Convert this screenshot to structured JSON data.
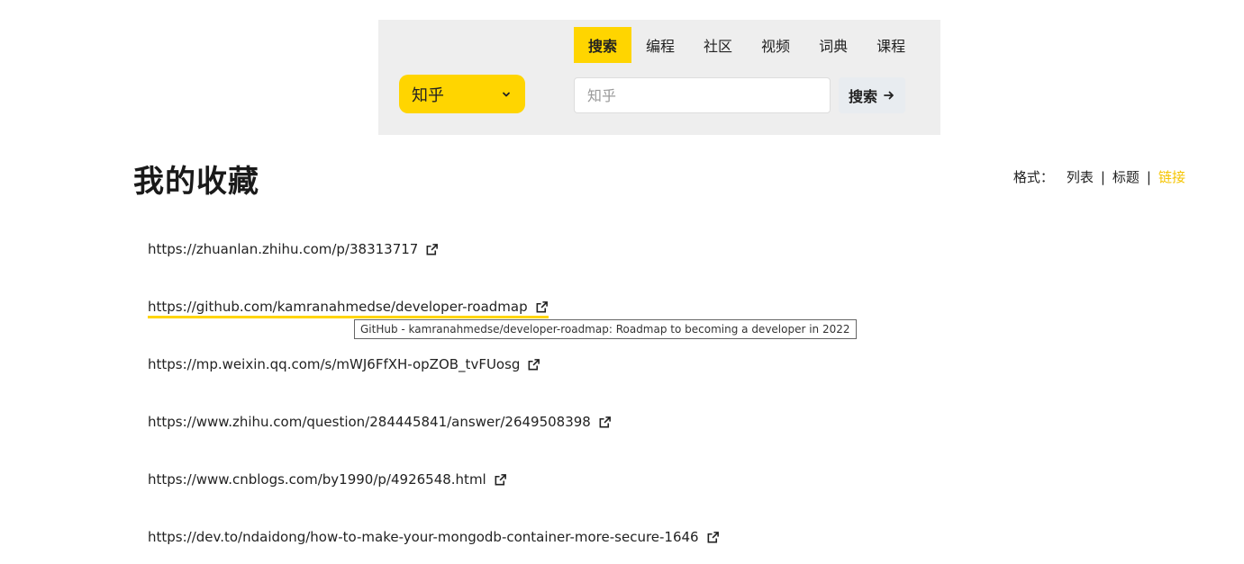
{
  "search": {
    "engine": "知乎",
    "categories": [
      "搜索",
      "编程",
      "社区",
      "视频",
      "词典",
      "课程"
    ],
    "placeholder": "知乎",
    "button_label": "搜索"
  },
  "page_title": "我的收藏",
  "format": {
    "label": "格式：",
    "options": [
      "列表",
      "标题",
      "链接"
    ],
    "active": "链接",
    "separator": "|"
  },
  "links": [
    "https://zhuanlan.zhihu.com/p/38313717",
    "https://github.com/kamranahmedse/developer-roadmap",
    "https://mp.weixin.qq.com/s/mWJ6FfXH-opZOB_tvFUosg",
    "https://www.zhihu.com/question/284445841/answer/2649508398",
    "https://www.cnblogs.com/by1990/p/4926548.html",
    "https://dev.to/ndaidong/how-to-make-your-mongodb-container-more-secure-1646"
  ],
  "tooltip": "GitHub - kamranahmedse/developer-roadmap: Roadmap to becoming a developer in 2022",
  "colors": {
    "accent": "#ffd500",
    "active_format": "#f5c400",
    "panel_bg": "#eeeeee"
  },
  "icons": {
    "link": "external-link-icon",
    "dropdown": "chevron-down-icon",
    "submit": "arrow-right-icon"
  }
}
